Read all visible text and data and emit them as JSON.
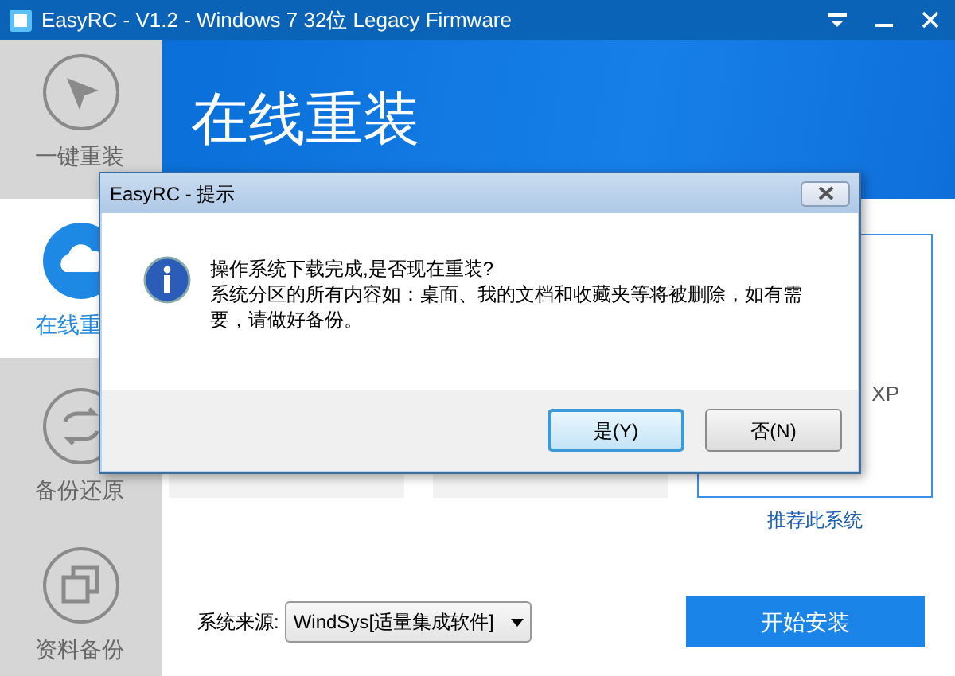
{
  "window": {
    "title": "EasyRC - V1.2 - Windows 7 32位 Legacy Firmware"
  },
  "sidebar": {
    "items": [
      {
        "label": "一键重装",
        "selected": false
      },
      {
        "label": "在线重",
        "selected": true
      },
      {
        "label": "备份还原",
        "selected": false
      },
      {
        "label": "资料备份",
        "selected": false
      }
    ]
  },
  "header": {
    "title": "在线重装"
  },
  "cards": [
    {
      "selected": false
    },
    {
      "selected": false
    },
    {
      "selected": true,
      "name": "XP",
      "link": "推荐此系统"
    }
  ],
  "source": {
    "label": "系统来源:",
    "value": "WindSys[适量集成软件]"
  },
  "start_button": "开始安装",
  "dialog": {
    "title": "EasyRC - 提示",
    "message": [
      "操作系统下载完成,是否现在重装?",
      "系统分区的所有内容如：桌面、我的文档和收藏夹等将被删除，如有需要，请做好备份。"
    ],
    "buttons": [
      {
        "label": "是(Y)",
        "selected": true
      },
      {
        "label": "否(N)",
        "selected": false
      }
    ]
  }
}
